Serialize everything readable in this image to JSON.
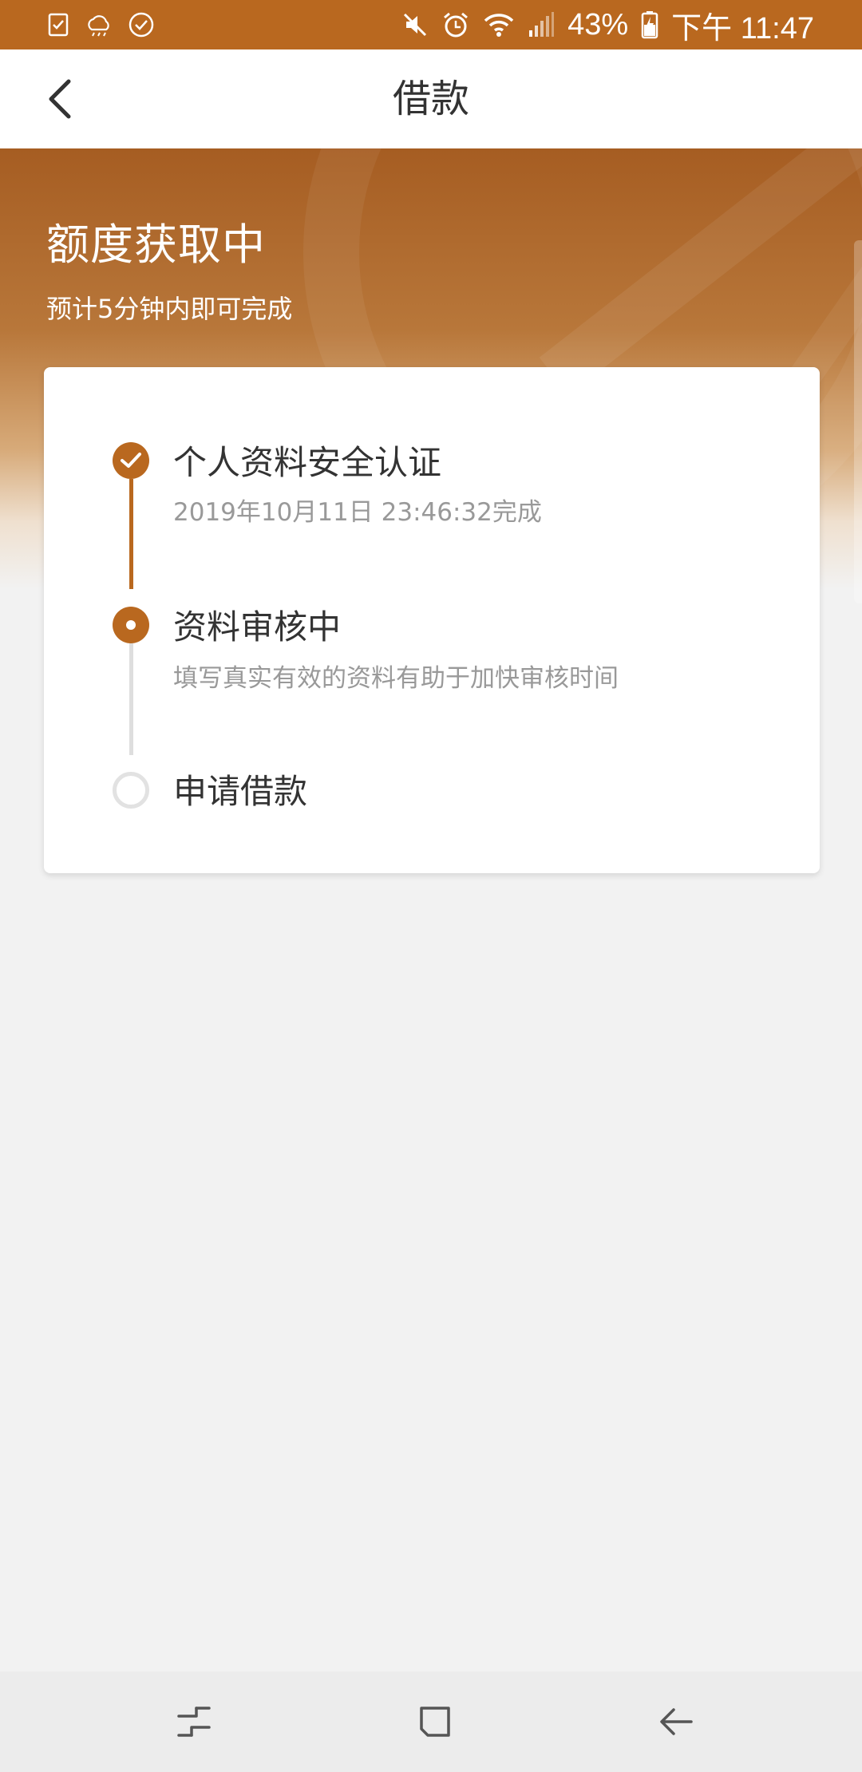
{
  "status_bar": {
    "battery_percent": "43%",
    "time": "下午 11:47",
    "icons_left": [
      "task-check-icon",
      "cloud-weather-icon",
      "check-circle-icon"
    ],
    "icons_right": [
      "mute-icon",
      "alarm-icon",
      "wifi-icon",
      "signal-icon",
      "battery-charging-icon"
    ]
  },
  "header": {
    "title": "借款",
    "back_icon": "chevron-left-icon"
  },
  "banner": {
    "title": "额度获取中",
    "subtitle": "预计5分钟内即可完成"
  },
  "progress": {
    "steps": [
      {
        "status": "done",
        "title": "个人资料安全认证",
        "description": "2019年10月11日 23:46:32完成"
      },
      {
        "status": "current",
        "title": "资料审核中",
        "description": "填写真实有效的资料有助于加快审核时间"
      },
      {
        "status": "pending",
        "title": "申请借款",
        "description": ""
      }
    ]
  },
  "colors": {
    "accent": "#b9681f",
    "pending_gray": "#dedede",
    "title_text": "#333333",
    "desc_text": "#999999",
    "page_bg": "#f2f2f2"
  },
  "nav_bar": {
    "buttons": [
      "recent-apps-icon",
      "home-icon",
      "back-arrow-icon"
    ]
  }
}
